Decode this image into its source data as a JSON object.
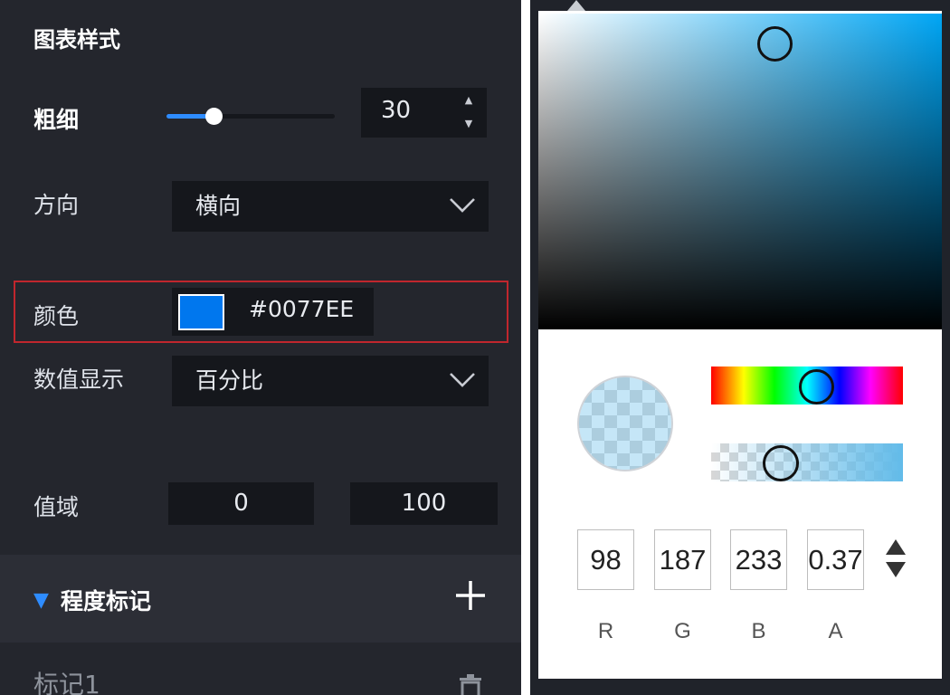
{
  "settings": {
    "section_title": "图表样式",
    "thickness": {
      "label": "粗细",
      "slider_fraction": 0.29,
      "value": "30"
    },
    "direction": {
      "label": "方向",
      "selected": "横向"
    },
    "color": {
      "label": "颜色",
      "hex": "#0077EE",
      "swatch_color": "#0077EE"
    },
    "value_display": {
      "label": "数值显示",
      "selected": "百分比"
    },
    "value_range": {
      "label": "值域",
      "min": "0",
      "max": "100"
    },
    "progress_markers": {
      "title": "程度标记",
      "add_icon": "plus-icon",
      "marker_label": "标记1",
      "delete_icon": "trash-icon"
    }
  },
  "color_picker": {
    "r": "98",
    "g": "187",
    "b": "233",
    "a": "0.37",
    "labels": [
      "R",
      "G",
      "B",
      "A"
    ],
    "toggle_icon": "up-down-arrows-icon"
  },
  "colors": {
    "panel_bg": "#24262D",
    "field_bg": "#15171C",
    "accent": "#2E8CFF",
    "highlight_border": "#C0262D"
  }
}
